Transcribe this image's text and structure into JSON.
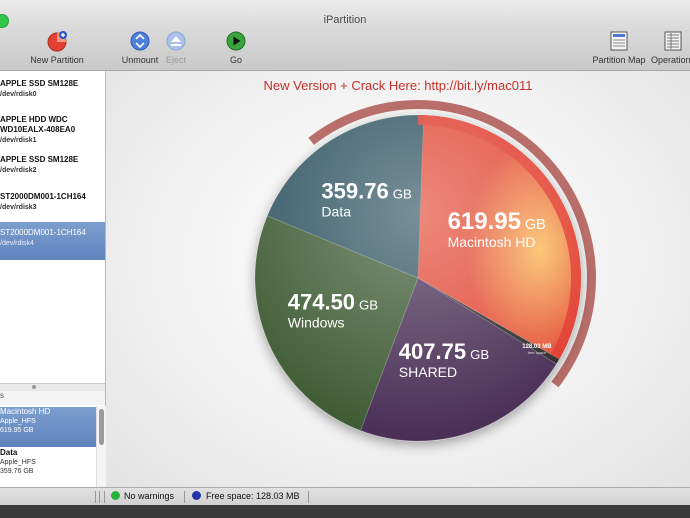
{
  "app": {
    "title": "iPartition"
  },
  "toolbar": {
    "new_partition": "New Partition",
    "unmount": "Unmount",
    "eject": "Eject",
    "go": "Go",
    "partition_map": "Partition Map",
    "operations": "Operations"
  },
  "disks": [
    {
      "name": "APPLE SSD SM128E",
      "device": "/dev/rdisk0"
    },
    {
      "name": "APPLE HDD WDC WD10EALX-408EA0",
      "name_line1": "APPLE HDD WDC",
      "name_line2": "WD10EALX-408EA0",
      "device": "/dev/rdisk1"
    },
    {
      "name": "APPLE SSD SM128E",
      "device": "/dev/rdisk2"
    },
    {
      "name": "ST2000DM001-1CH164",
      "device": "/dev/rdisk3"
    },
    {
      "name": "ST2000DM001-1CH164",
      "device": "/dev/rdisk4"
    }
  ],
  "partitions_header": "s",
  "partitions_list": [
    {
      "name": "Macintosh HD",
      "fs": "Apple_HFS",
      "size": "619.95 GB"
    },
    {
      "name": "Data",
      "fs": "Apple_HFS",
      "size": "359.76 GB"
    }
  ],
  "promo": "New Version + Crack Here:  http://bit.ly/mac011",
  "chart_data": {
    "type": "pie",
    "unit": "GB",
    "slices": [
      {
        "label": "Macintosh HD",
        "value": 619.95,
        "display": "619.95",
        "color": "#e24a35"
      },
      {
        "label": "",
        "value": 0.128,
        "display": "128.03",
        "sub": "free space",
        "unit": "MB",
        "color": "#2a2a2a"
      },
      {
        "label": "SHARED",
        "value": 407.75,
        "display": "407.75",
        "color": "#4a2d57"
      },
      {
        "label": "Windows",
        "value": 474.5,
        "display": "474.50",
        "color": "#3c5a30"
      },
      {
        "label": "Data",
        "value": 359.76,
        "display": "359.76",
        "color": "#2f5360"
      }
    ]
  },
  "status": {
    "warnings": "No warnings",
    "free_space": "Free space: 128.03 MB",
    "ok_color": "#27b43a",
    "info_color": "#2533a8"
  }
}
